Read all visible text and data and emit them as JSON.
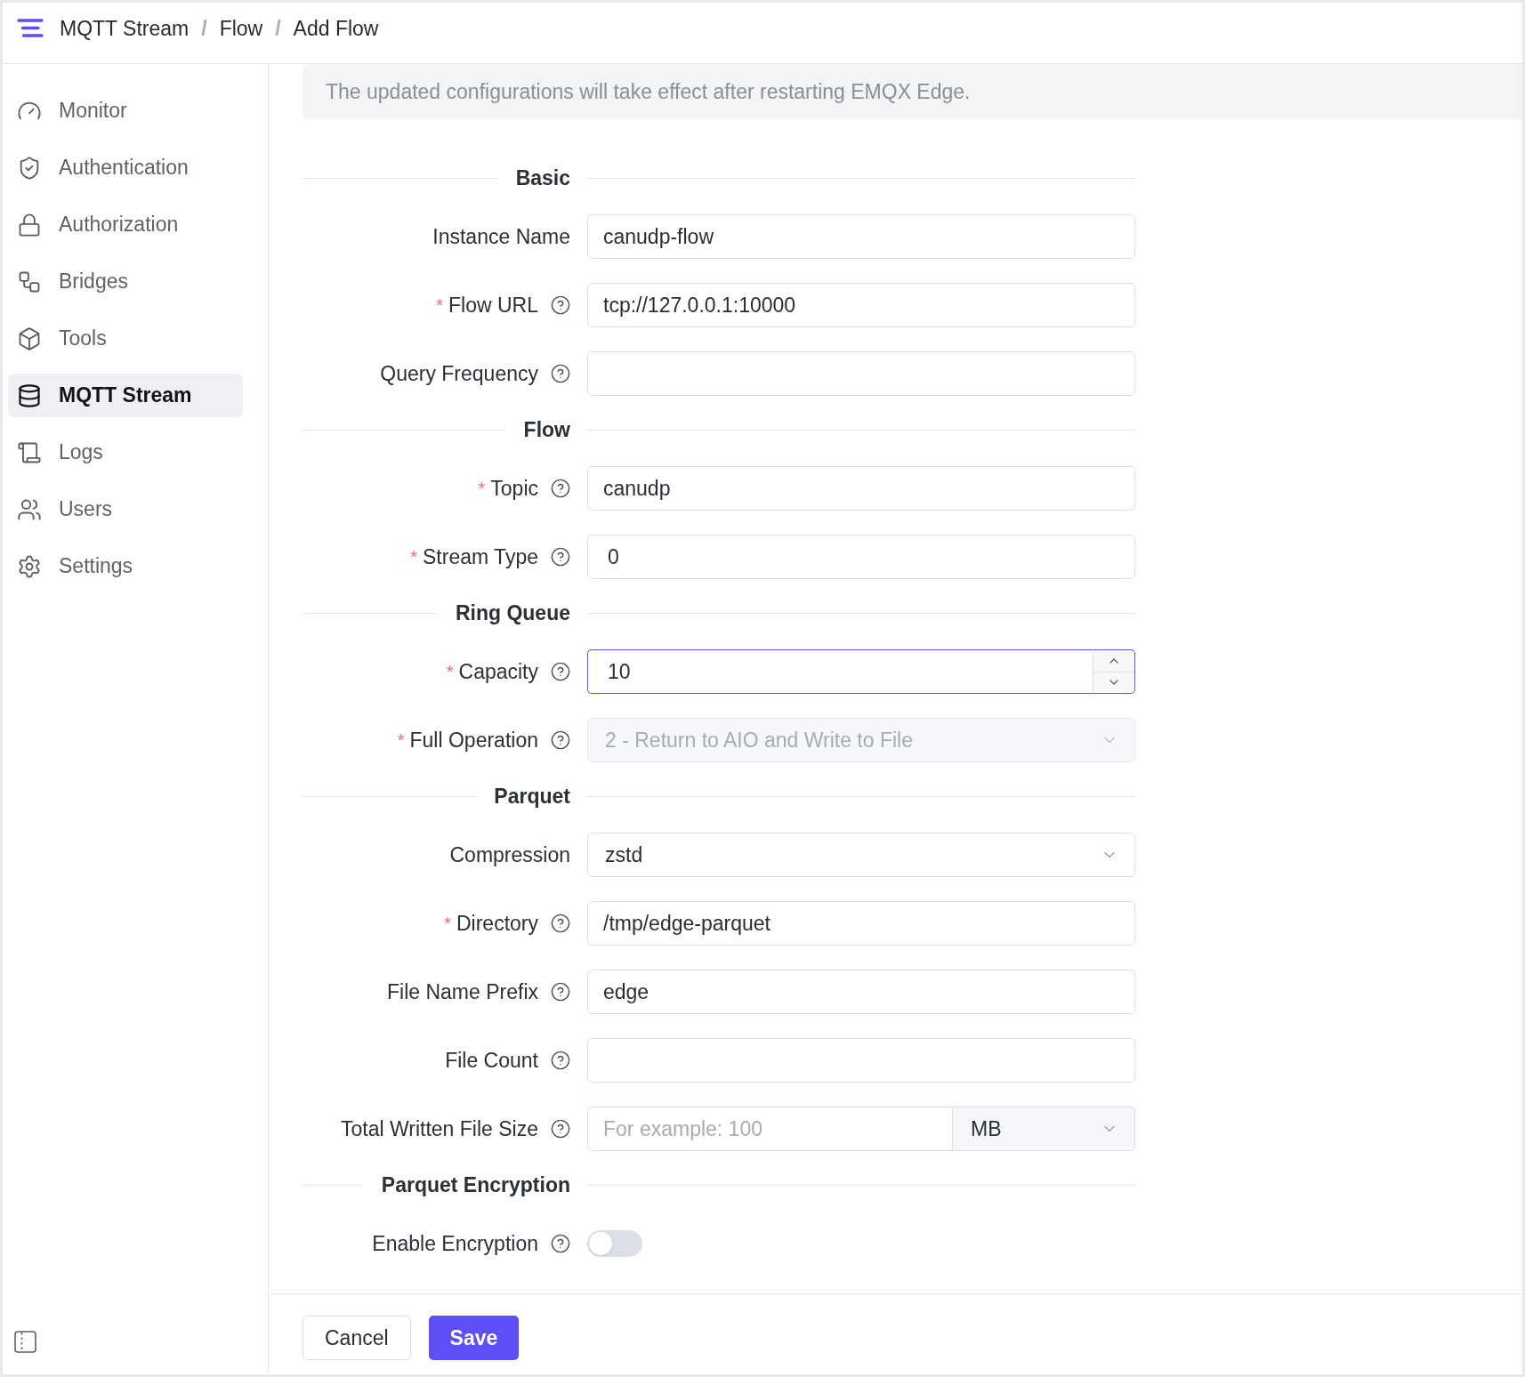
{
  "header": {
    "breadcrumb": [
      {
        "label": "MQTT Stream",
        "separator": "/"
      },
      {
        "label": "Flow",
        "separator": "/"
      },
      {
        "label": "Add Flow"
      }
    ]
  },
  "sidebar": {
    "items": [
      {
        "label": "Monitor",
        "selected": false
      },
      {
        "label": "Authentication",
        "selected": false
      },
      {
        "label": "Authorization",
        "selected": false
      },
      {
        "label": "Bridges",
        "selected": false
      },
      {
        "label": "Tools",
        "selected": false
      },
      {
        "label": "MQTT Stream",
        "selected": true
      },
      {
        "label": "Logs",
        "selected": false
      },
      {
        "label": "Users",
        "selected": false
      },
      {
        "label": "Settings",
        "selected": false
      }
    ]
  },
  "banner": {
    "text": "The updated configurations will take effect after restarting EMQX Edge."
  },
  "form": {
    "sections": [
      {
        "title": "Basic",
        "fields": [
          {
            "kind": "text",
            "label": "Instance Name",
            "help": false,
            "value": "canudp-flow"
          },
          {
            "kind": "text",
            "label": "Flow URL",
            "required_mark": "*",
            "help": true,
            "value": "tcp://127.0.0.1:10000"
          },
          {
            "kind": "text",
            "label": "Query Frequency",
            "help": true
          }
        ]
      },
      {
        "title": "Flow",
        "fields": [
          {
            "kind": "text",
            "label": "Topic",
            "required_mark": "*",
            "help": true,
            "value": "canudp"
          },
          {
            "kind": "number",
            "label": "Stream Type",
            "required_mark": "*",
            "help": true,
            "value": "0",
            "focused": false
          }
        ]
      },
      {
        "title": "Ring Queue",
        "fields": [
          {
            "kind": "number",
            "label": "Capacity",
            "required_mark": "*",
            "help": true,
            "value": "10",
            "focused": true
          },
          {
            "kind": "select",
            "label": "Full Operation",
            "required_mark": "*",
            "help": true,
            "value": "2 - Return to AIO and Write to File",
            "disabled": true
          }
        ]
      },
      {
        "title": "Parquet",
        "fields": [
          {
            "kind": "select",
            "label": "Compression",
            "help": false,
            "value": "zstd",
            "disabled": false
          },
          {
            "kind": "text",
            "label": "Directory",
            "required_mark": "*",
            "help": true,
            "value": "/tmp/edge-parquet"
          },
          {
            "kind": "text",
            "label": "File Name Prefix",
            "help": true,
            "value": "edge"
          },
          {
            "kind": "text",
            "label": "File Count",
            "help": true
          },
          {
            "kind": "size",
            "label": "Total Written File Size",
            "help": true,
            "placeholder": "For example: 100",
            "unit": "MB"
          }
        ]
      },
      {
        "title": "Parquet Encryption",
        "fields": [
          {
            "kind": "switch",
            "label": "Enable Encryption",
            "help": true,
            "on": false
          }
        ]
      }
    ]
  },
  "footer": {
    "buttons": [
      {
        "label": "Cancel",
        "kind": "secondary"
      },
      {
        "label": "Save",
        "kind": "primary"
      }
    ]
  }
}
